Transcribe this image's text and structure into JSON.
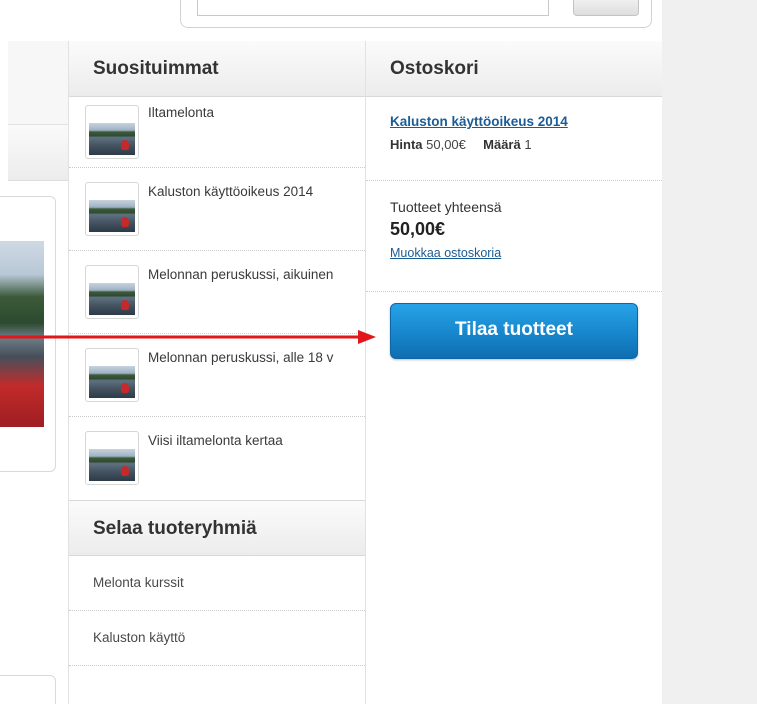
{
  "popular": {
    "title": "Suosituimmat",
    "items": [
      {
        "title": "Iltamelonta"
      },
      {
        "title": "Kaluston käyttöoikeus 2014"
      },
      {
        "title": "Melonnan peruskussi, aikuinen"
      },
      {
        "title": "Melonnan peruskussi, alle 18 v"
      },
      {
        "title": "Viisi iltamelonta kertaa"
      }
    ]
  },
  "browse": {
    "title": "Selaa tuoteryhmiä",
    "items": [
      {
        "label": "Melonta kurssit"
      },
      {
        "label": "Kaluston käyttö"
      }
    ]
  },
  "cart": {
    "title": "Ostoskori",
    "item_name": "Kaluston käyttöoikeus 2014",
    "price_label": "Hinta",
    "price_value": "50,00€",
    "qty_label": "Määrä",
    "qty_value": "1",
    "totals_label": "Tuotteet yhteensä",
    "totals_value": "50,00€",
    "edit_link": "Muokkaa ostoskoria",
    "order_button": "Tilaa tuotteet"
  },
  "colors": {
    "link": "#1b5c94",
    "button": "#1786cc",
    "annotation_arrow": "#e0161a"
  }
}
